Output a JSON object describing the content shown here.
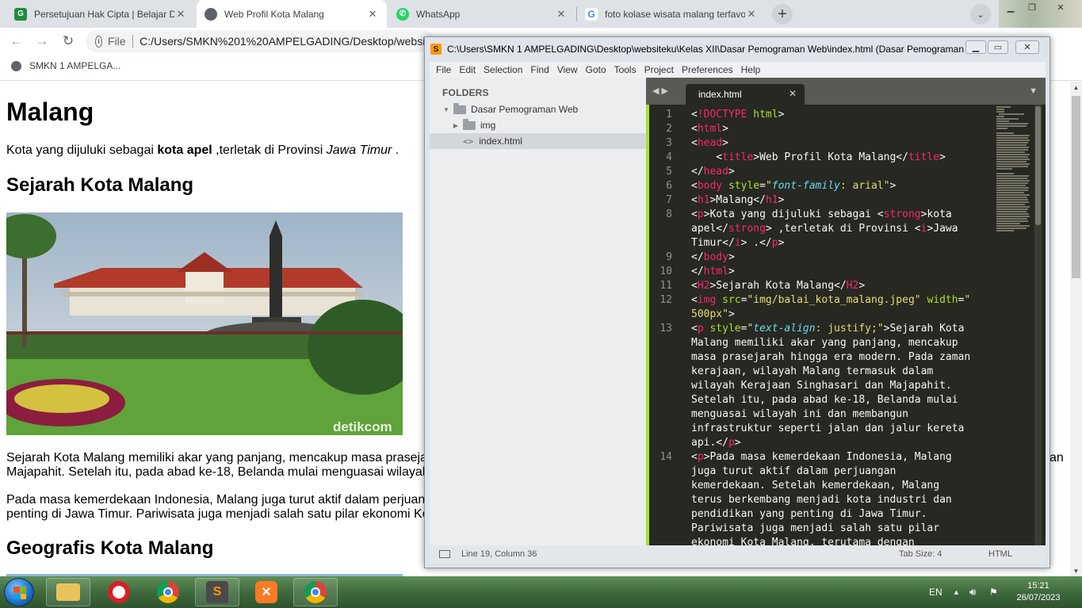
{
  "browser": {
    "tabs": [
      {
        "title": "Persetujuan Hak Cipta | Belajar D",
        "icon": "classroom-icon",
        "active": false
      },
      {
        "title": "Web Profil Kota Malang",
        "icon": "globe-icon",
        "active": true
      },
      {
        "title": "WhatsApp",
        "icon": "whatsapp-icon",
        "active": false
      },
      {
        "title": "foto kolase wisata malang terfavo",
        "icon": "google-icon",
        "active": false
      }
    ],
    "address": {
      "scheme": "File",
      "url": "C:/Users/SMKN%201%20AMPELGADING/Desktop/website"
    },
    "bookmark": "SMKN 1 AMPELGA..."
  },
  "page": {
    "h1": "Malang",
    "intro": {
      "pre": "Kota yang dijuluki sebagai ",
      "strong": "kota apel",
      "mid": " ,terletak di Provinsi ",
      "italic": "Jawa Timur",
      "post": " ."
    },
    "h2_sejarah": "Sejarah Kota Malang",
    "photo_watermark": "detikcom",
    "para1_line1": "Sejarah Kota Malang memiliki akar yang panjang, mencakup masa praseja",
    "para1_line1_tail": "an",
    "para1_line2": "Majapahit. Setelah itu, pada abad ke-18, Belanda mulai menguasai wilayah",
    "para2_line1": "Pada masa kemerdekaan Indonesia, Malang juga turut aktif dalam perjuan",
    "para2_line2": "penting di Jawa Timur. Pariwisata juga menjadi salah satu pilar ekonomi Ko",
    "h2_geografis": "Geografis Kota Malang"
  },
  "sublime": {
    "title": "C:\\Users\\SMKN 1 AMPELGADING\\Desktop\\websiteku\\Kelas XII\\Dasar Pemograman Web\\index.html (Dasar Pemograman...",
    "menu": [
      "File",
      "Edit",
      "Selection",
      "Find",
      "View",
      "Goto",
      "Tools",
      "Project",
      "Preferences",
      "Help"
    ],
    "sidebar": {
      "header": "FOLDERS",
      "root": "Dasar Pemograman Web",
      "folder": "img",
      "file": "index.html"
    },
    "tab": "index.html",
    "status": {
      "position": "Line 19, Column 36",
      "tab_size": "Tab Size: 4",
      "syntax": "HTML"
    },
    "line_numbers": [
      "1",
      "2",
      "3",
      "4",
      "5",
      "6",
      "7",
      "8",
      "9",
      "10",
      "11",
      "12",
      "13",
      "14"
    ]
  },
  "taskbar": {
    "apps": [
      "file-explorer-icon",
      "opera-icon",
      "chrome-icon",
      "sublime-text-icon",
      "xampp-icon",
      "chrome-profile-icon"
    ],
    "language": "EN",
    "time": "15:21",
    "date": "26/07/2023"
  },
  "colors": {
    "st_background": "#272822",
    "st_keyword": "#f92672",
    "st_attribute": "#a6e22e",
    "st_string": "#e6db74",
    "st_property": "#66d9ef"
  }
}
